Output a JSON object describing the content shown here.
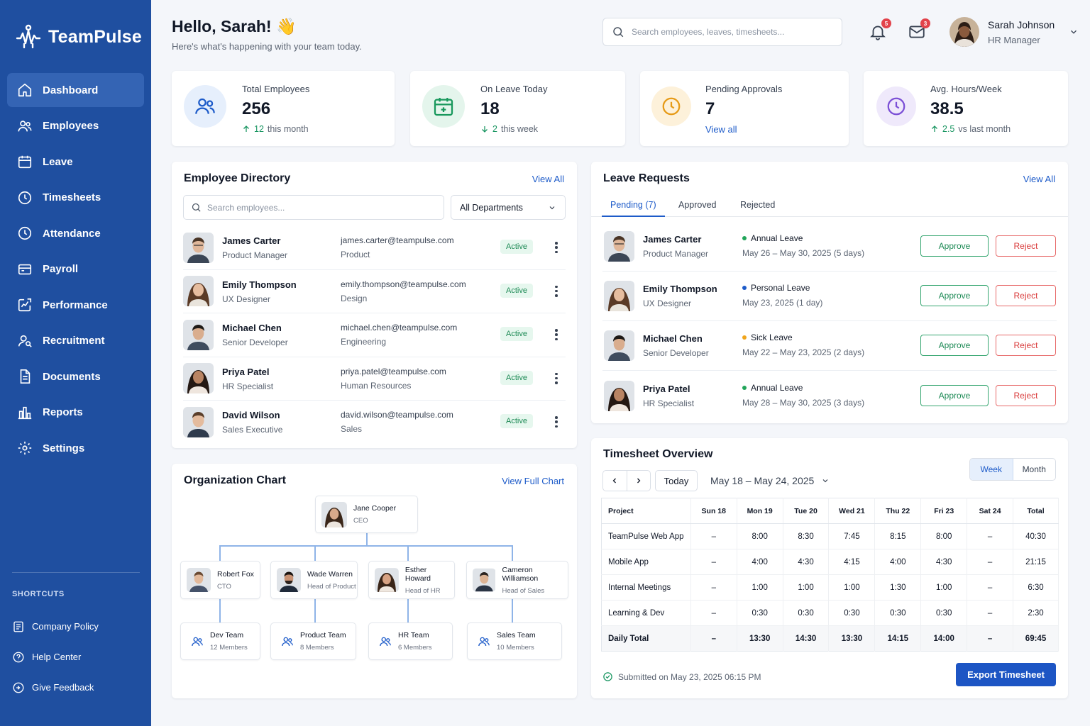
{
  "brand": {
    "name": "TeamPulse"
  },
  "sidebar": {
    "items": [
      {
        "label": "Dashboard",
        "icon": "home-icon",
        "active": true
      },
      {
        "label": "Employees",
        "icon": "users-icon"
      },
      {
        "label": "Leave",
        "icon": "calendar-icon"
      },
      {
        "label": "Timesheets",
        "icon": "clock-icon"
      },
      {
        "label": "Attendance",
        "icon": "clock-icon"
      },
      {
        "label": "Payroll",
        "icon": "wallet-icon"
      },
      {
        "label": "Performance",
        "icon": "chart-edit-icon"
      },
      {
        "label": "Recruitment",
        "icon": "user-search-icon"
      },
      {
        "label": "Documents",
        "icon": "document-icon"
      },
      {
        "label": "Reports",
        "icon": "report-icon"
      },
      {
        "label": "Settings",
        "icon": "gear-icon"
      }
    ],
    "shortcuts_title": "SHORTCUTS",
    "shortcuts": [
      {
        "label": "Company Policy",
        "icon": "policy-icon"
      },
      {
        "label": "Help Center",
        "icon": "help-icon"
      },
      {
        "label": "Give Feedback",
        "icon": "feedback-icon"
      }
    ]
  },
  "header": {
    "greeting": "Hello, Sarah! 👋",
    "subtitle": "Here's what's happening with your team today.",
    "search_placeholder": "Search employees, leaves, timesheets...",
    "notifications_count": "5",
    "messages_count": "3",
    "user_name": "Sarah Johnson",
    "user_role": "HR Manager"
  },
  "stats": [
    {
      "label": "Total Employees",
      "value": "256",
      "delta": "12",
      "delta_text": "this month",
      "trend": "up"
    },
    {
      "label": "On Leave Today",
      "value": "18",
      "delta": "2",
      "delta_text": "this week",
      "trend": "down"
    },
    {
      "label": "Pending Approvals",
      "value": "7",
      "link": "View all"
    },
    {
      "label": "Avg. Hours/Week",
      "value": "38.5",
      "delta": "2.5",
      "delta_text": "vs last month",
      "trend": "up"
    }
  ],
  "directory": {
    "title": "Employee Directory",
    "view_all": "View All",
    "search_placeholder": "Search employees...",
    "department_filter": "All Departments",
    "employees": [
      {
        "name": "James Carter",
        "role": "Product Manager",
        "email": "james.carter@teampulse.com",
        "department": "Product",
        "status": "Active"
      },
      {
        "name": "Emily Thompson",
        "role": "UX Designer",
        "email": "emily.thompson@teampulse.com",
        "department": "Design",
        "status": "Active"
      },
      {
        "name": "Michael Chen",
        "role": "Senior Developer",
        "email": "michael.chen@teampulse.com",
        "department": "Engineering",
        "status": "Active"
      },
      {
        "name": "Priya Patel",
        "role": "HR Specialist",
        "email": "priya.patel@teampulse.com",
        "department": "Human Resources",
        "status": "Active"
      },
      {
        "name": "David Wilson",
        "role": "Sales Executive",
        "email": "david.wilson@teampulse.com",
        "department": "Sales",
        "status": "Active"
      }
    ]
  },
  "org": {
    "title": "Organization Chart",
    "view_full": "View Full Chart",
    "ceo": {
      "name": "Jane Cooper",
      "role": "CEO"
    },
    "leads": [
      {
        "name": "Robert Fox",
        "role": "CTO"
      },
      {
        "name": "Wade Warren",
        "role": "Head of Product"
      },
      {
        "name": "Esther Howard",
        "role": "Head of HR"
      },
      {
        "name": "Cameron Williamson",
        "role": "Head of Sales"
      }
    ],
    "teams": [
      {
        "name": "Dev Team",
        "members": "12 Members"
      },
      {
        "name": "Product Team",
        "members": "8 Members"
      },
      {
        "name": "HR Team",
        "members": "6 Members"
      },
      {
        "name": "Sales Team",
        "members": "10 Members"
      }
    ]
  },
  "leave": {
    "title": "Leave Requests",
    "view_all": "View All",
    "tabs": [
      "Pending (7)",
      "Approved",
      "Rejected"
    ],
    "approve_label": "Approve",
    "reject_label": "Reject",
    "requests": [
      {
        "name": "James Carter",
        "role": "Product Manager",
        "type": "Annual Leave",
        "dates": "May 26 – May 30, 2025 (5 days)",
        "color": "#22a55a"
      },
      {
        "name": "Emily Thompson",
        "role": "UX Designer",
        "type": "Personal Leave",
        "dates": "May 23, 2025 (1 day)",
        "color": "#1d5bc9"
      },
      {
        "name": "Michael Chen",
        "role": "Senior Developer",
        "type": "Sick Leave",
        "dates": "May 22 – May 23, 2025 (2 days)",
        "color": "#f0a51c"
      },
      {
        "name": "Priya Patel",
        "role": "HR Specialist",
        "type": "Annual Leave",
        "dates": "May 28 – May 30, 2025 (3 days)",
        "color": "#22a55a"
      }
    ]
  },
  "timesheet": {
    "title": "Timesheet Overview",
    "views": [
      "Week",
      "Month"
    ],
    "today_label": "Today",
    "range": "May 18 – May 24, 2025",
    "columns": [
      "Project",
      "Sun 18",
      "Mon 19",
      "Tue 20",
      "Wed 21",
      "Thu 22",
      "Fri 23",
      "Sat 24",
      "Total"
    ],
    "rows": [
      [
        "TeamPulse Web App",
        "–",
        "8:00",
        "8:30",
        "7:45",
        "8:15",
        "8:00",
        "–",
        "40:30"
      ],
      [
        "Mobile App",
        "–",
        "4:00",
        "4:30",
        "4:15",
        "4:00",
        "4:30",
        "–",
        "21:15"
      ],
      [
        "Internal Meetings",
        "–",
        "1:00",
        "1:00",
        "1:00",
        "1:30",
        "1:00",
        "–",
        "6:30"
      ],
      [
        "Learning & Dev",
        "–",
        "0:30",
        "0:30",
        "0:30",
        "0:30",
        "0:30",
        "–",
        "2:30"
      ]
    ],
    "total_row": [
      "Daily Total",
      "–",
      "13:30",
      "14:30",
      "13:30",
      "14:15",
      "14:00",
      "–",
      "69:45"
    ],
    "submitted": "Submitted on May 23, 2025 06:15 PM",
    "export_label": "Export Timesheet"
  },
  "colors": {
    "sidebar": "#1f4fa0",
    "accent": "#1d5bc9",
    "success": "#16945f",
    "danger": "#d93b3b"
  }
}
